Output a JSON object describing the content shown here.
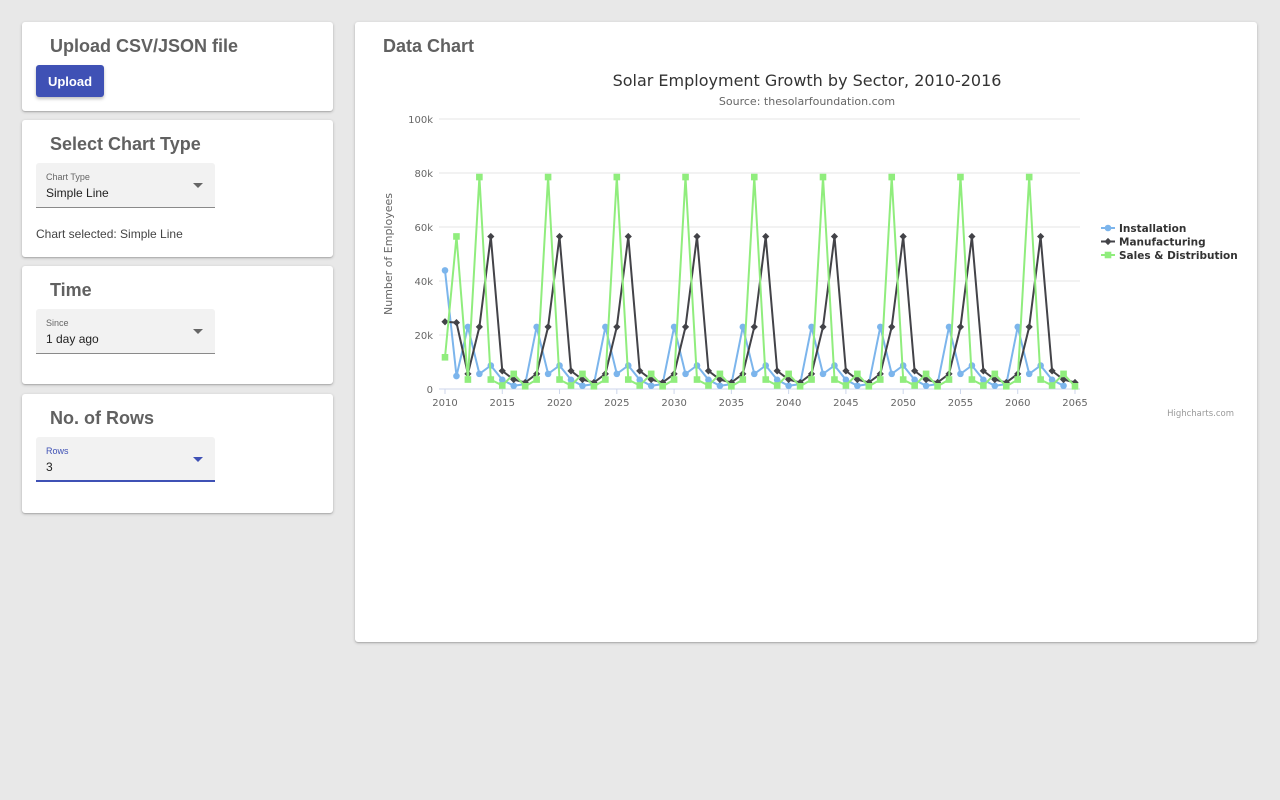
{
  "upload_card": {
    "title": "Upload CSV/JSON file",
    "button_label": "Upload"
  },
  "chart_type_card": {
    "title": "Select Chart Type",
    "select_label": "Chart Type",
    "select_value": "Simple Line",
    "helper_text": "Chart selected: Simple Line"
  },
  "time_card": {
    "title": "Time",
    "select_label": "Since",
    "select_value": "1 day ago"
  },
  "rows_card": {
    "title": "No. of Rows",
    "select_label": "Rows",
    "select_value": "3"
  },
  "chart_panel": {
    "title": "Data Chart"
  },
  "colors": {
    "accent": "#3f51b5",
    "installation": "#7cb5ec",
    "manufacturing": "#434348",
    "sales": "#90ed7d"
  },
  "chart_data": {
    "type": "line",
    "title": "Solar Employment Growth by Sector, 2010-2016",
    "subtitle": "Source: thesolarfoundation.com",
    "ylabel": "Number of Employees",
    "xlabel": "",
    "xlim": [
      2010,
      2065
    ],
    "ylim": [
      0,
      100000
    ],
    "x_ticks": [
      "2010",
      "2015",
      "2020",
      "2025",
      "2030",
      "2035",
      "2040",
      "2045",
      "2050",
      "2055",
      "2060",
      "2065"
    ],
    "y_ticks": [
      "0",
      "20k",
      "40k",
      "60k",
      "80k",
      "100k"
    ],
    "legend_position": "right",
    "credits": "Highcharts.com",
    "x_start": 2010,
    "series": [
      {
        "name": "Installation",
        "marker": "circle",
        "values": [
          43934,
          4800,
          23000,
          5600,
          8700,
          3400,
          1200,
          1800,
          23000,
          5600,
          8700,
          3400,
          1200,
          1800,
          23000,
          5600,
          8700,
          3400,
          1200,
          1800,
          23000,
          5600,
          8700,
          3400,
          1200,
          1800,
          23000,
          5600,
          8700,
          3400,
          1200,
          1800,
          23000,
          5600,
          8700,
          3400,
          1200,
          1800,
          23000,
          5600,
          8700,
          3400,
          1200,
          1800,
          23000,
          5600,
          8700,
          3400,
          1200,
          1800,
          23000,
          5600,
          8700,
          3400,
          1200
        ]
      },
      {
        "name": "Manufacturing",
        "marker": "diamond",
        "values": [
          24916,
          24600,
          5600,
          23000,
          56500,
          6700,
          3500,
          2400,
          5600,
          23000,
          56500,
          6700,
          3500,
          2400,
          5600,
          23000,
          56500,
          6700,
          3500,
          2400,
          5600,
          23000,
          56500,
          6700,
          3500,
          2400,
          5600,
          23000,
          56500,
          6700,
          3500,
          2400,
          5600,
          23000,
          56500,
          6700,
          3500,
          2400,
          5600,
          23000,
          56500,
          6700,
          3500,
          2400,
          5600,
          23000,
          56500,
          6700,
          3500,
          2400,
          5600,
          23000,
          56500,
          6700,
          3500,
          2400
        ]
      },
      {
        "name": "Sales & Distribution",
        "marker": "square",
        "values": [
          11744,
          56500,
          3500,
          78500,
          3500,
          1300,
          5600,
          1000,
          3500,
          78500,
          3500,
          1300,
          5600,
          1000,
          3500,
          78500,
          3500,
          1300,
          5600,
          1000,
          3500,
          78500,
          3500,
          1300,
          5600,
          1000,
          3500,
          78500,
          3500,
          1300,
          5600,
          1000,
          3500,
          78500,
          3500,
          1300,
          5600,
          1000,
          3500,
          78500,
          3500,
          1300,
          5600,
          1000,
          3500,
          78500,
          3500,
          1300,
          5600,
          1000,
          3500,
          78500,
          3500,
          1300,
          5600,
          1000
        ]
      }
    ]
  }
}
